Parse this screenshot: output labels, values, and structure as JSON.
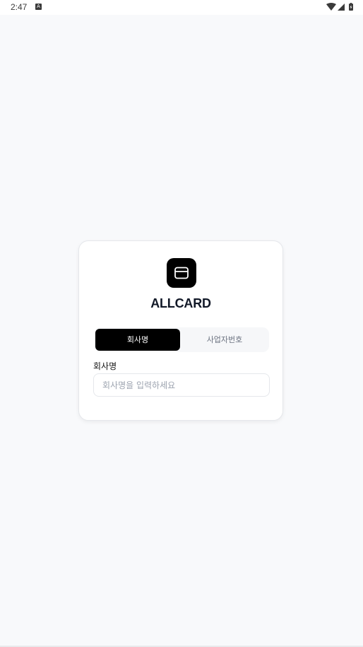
{
  "status_bar": {
    "time": "2:47",
    "notification_icon": "A",
    "icons": [
      "wifi-icon",
      "signal-icon",
      "battery-icon"
    ]
  },
  "app": {
    "brand": "ALLCARD",
    "logo_icon": "credit-card-icon"
  },
  "tabs": [
    {
      "label": "회사명",
      "active": true
    },
    {
      "label": "사업자번호",
      "active": false
    }
  ],
  "form": {
    "label": "회사명",
    "value": "",
    "placeholder": "회사명을 입력하세요"
  },
  "colors": {
    "background": "#f8f9fb",
    "card": "#ffffff",
    "accent": "#000000",
    "brand_text": "#111827",
    "placeholder": "#9ca3af"
  }
}
